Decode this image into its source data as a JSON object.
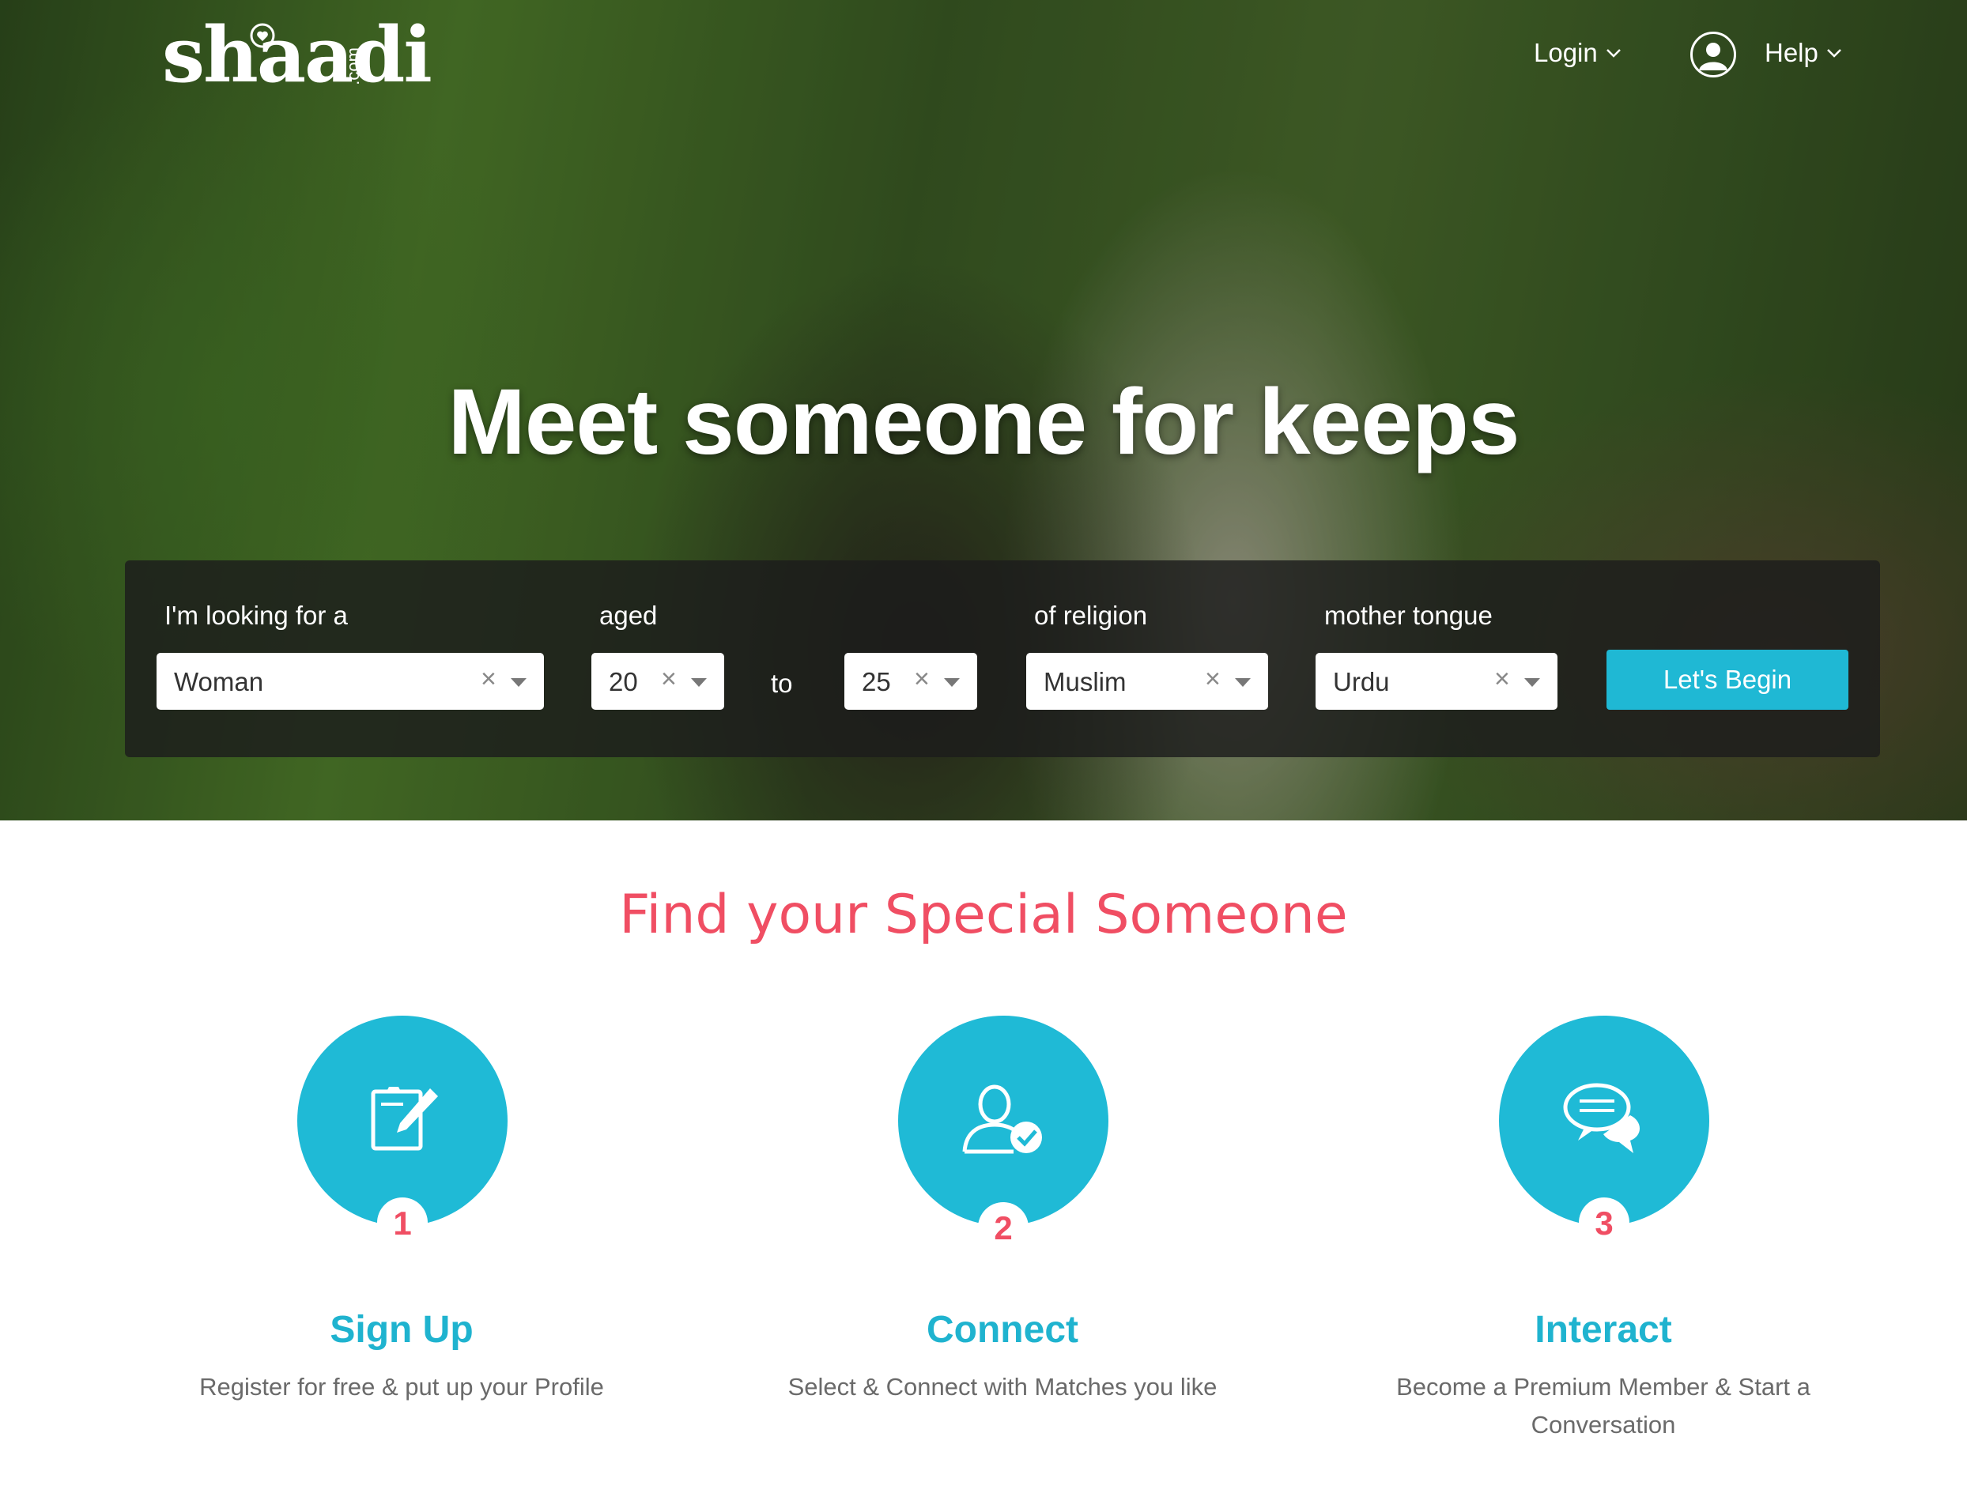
{
  "brand": {
    "logo_text": "shaadi",
    "logo_suffix": ".com"
  },
  "nav": {
    "login_label": "Login",
    "help_label": "Help"
  },
  "hero": {
    "headline": "Meet someone for keeps"
  },
  "search": {
    "looking_for_label": "I'm looking for a",
    "looking_for_value": "Woman",
    "aged_label": "aged",
    "age_from": "20",
    "to_label": "to",
    "age_to": "25",
    "religion_label": "of religion",
    "religion_value": "Muslim",
    "tongue_label": "mother tongue",
    "tongue_value": "Urdu",
    "clear_glyph": "×",
    "submit_label": "Let's Begin"
  },
  "steps_section": {
    "title": "Find your Special Someone",
    "steps": [
      {
        "number": "1",
        "title": "Sign Up",
        "description": "Register for free & put up your Profile",
        "icon": "edit-form-icon"
      },
      {
        "number": "2",
        "title": "Connect",
        "description": "Select & Connect with Matches you like",
        "icon": "user-check-icon"
      },
      {
        "number": "3",
        "title": "Interact",
        "description": "Become a Premium Member & Start a Conversation",
        "icon": "chat-bubbles-icon"
      }
    ]
  },
  "colors": {
    "accent": "#1fb8d4",
    "headline_pink": "#f04e63",
    "step_number": "#f04e63"
  }
}
